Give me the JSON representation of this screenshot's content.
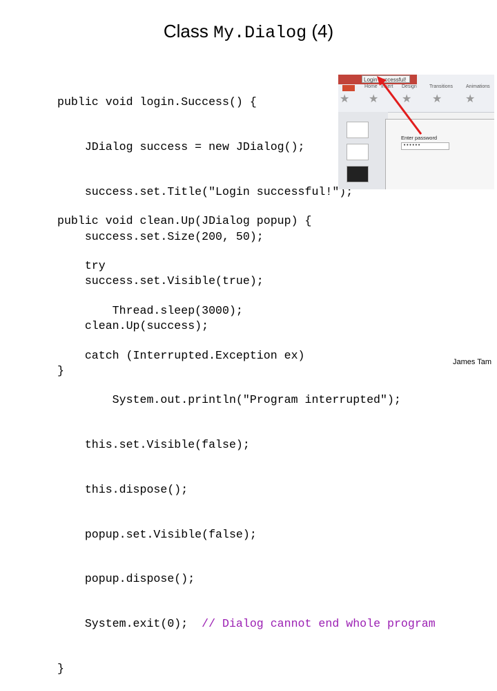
{
  "slide": {
    "title_prefix": "Class ",
    "title_code": "My.Dialog",
    "title_suffix": " (4)",
    "author": "James Tam"
  },
  "code_block_1": [
    "public void login.Success() {",
    "    JDialog success = new JDialog();",
    "    success.set.Title(\"Login successful!\");",
    "    success.set.Size(200, 50);",
    "    success.set.Visible(true);",
    "    clean.Up(success);",
    "}"
  ],
  "code_block_2": [
    "public void clean.Up(JDialog popup) {",
    "    try",
    "        Thread.sleep(3000);",
    "    catch (Interrupted.Exception ex)",
    "        System.out.println(\"Program interrupted\");",
    "    this.set.Visible(false);",
    "    this.dispose();",
    "    popup.set.Visible(false);",
    "    popup.dispose();",
    "    System.exit(0);  "
  ],
  "code_comment": "// Dialog cannot end whole program",
  "code_block_2_end": "}",
  "screenshot": {
    "window_title": "Login successful!",
    "tabs": [
      "Home",
      "Insert",
      "Design",
      "Transitions",
      "Animations"
    ],
    "dialog_label": "Enter password",
    "dialog_value": "••••••"
  },
  "colors": {
    "comment": "#9b1fb3",
    "arrow": "#e11d1d",
    "titlebar": "#c1433a"
  }
}
